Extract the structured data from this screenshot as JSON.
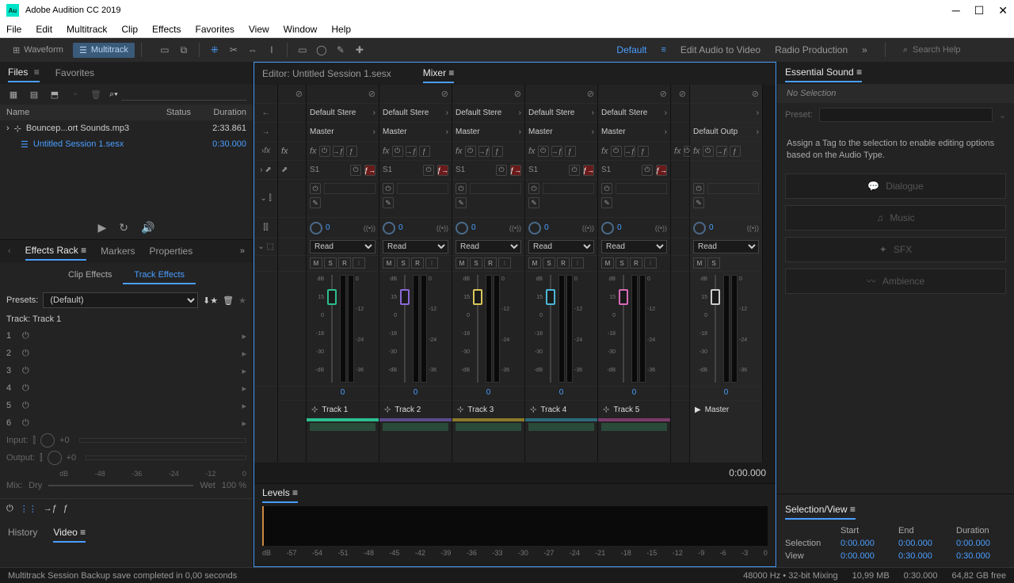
{
  "app": {
    "title": "Adobe Audition CC 2019",
    "icon_text": "Au"
  },
  "menu": [
    "File",
    "Edit",
    "Multitrack",
    "Clip",
    "Effects",
    "Favorites",
    "View",
    "Window",
    "Help"
  ],
  "modes": {
    "waveform": "Waveform",
    "multitrack": "Multitrack"
  },
  "workspaces": {
    "default": "Default",
    "eav": "Edit Audio to Video",
    "radio": "Radio Production"
  },
  "search": {
    "placeholder": "Search Help"
  },
  "files": {
    "tab1": "Files",
    "tab2": "Favorites",
    "headers": {
      "name": "Name",
      "status": "Status",
      "duration": "Duration"
    },
    "rows": [
      {
        "name": "Bouncep...ort Sounds.mp3",
        "dur": "2:33.861"
      },
      {
        "name": "Untitled Session 1.sesx",
        "dur": "0:30.000"
      }
    ]
  },
  "fx": {
    "panel": "Effects Rack",
    "markers": "Markers",
    "props": "Properties",
    "clipfx": "Clip Effects",
    "trackfx": "Track Effects",
    "presets_label": "Presets:",
    "preset_value": "(Default)",
    "track_label": "Track: Track 1",
    "input": "Input:",
    "output": "Output:",
    "plus0": "+0",
    "scale": [
      "dB",
      "-48",
      "-36",
      "-24",
      "-12",
      "0"
    ],
    "mix": "Mix:",
    "dry": "Dry",
    "wet": "Wet",
    "pct": "100 %"
  },
  "history": {
    "history": "History",
    "video": "Video"
  },
  "mixer": {
    "editor_tab": "Editor: Untitled Session 1.sesx",
    "mixer_tab": "Mixer",
    "default_stereo": "Default Stere",
    "master": "Master",
    "default_output": "Default Outp",
    "read": "Read",
    "s1": "S1",
    "pan": "0",
    "fader_scale": [
      "dB",
      "15",
      "0",
      "-18",
      "-30",
      "-dB"
    ],
    "meter_scale": [
      "0",
      "-12",
      "-24",
      "-36"
    ],
    "tracks": [
      {
        "name": "Track 1",
        "color": "#2dbd8e",
        "handle": "#2dbd8e"
      },
      {
        "name": "Track 2",
        "color": "#5a4a8a",
        "handle": "#8a6ad8"
      },
      {
        "name": "Track 3",
        "color": "#8a7a2a",
        "handle": "#d8c85a"
      },
      {
        "name": "Track 4",
        "color": "#2a6a7a",
        "handle": "#4ab8d8"
      },
      {
        "name": "Track 5",
        "color": "#7a3a6a",
        "handle": "#d86ab8"
      }
    ],
    "master_name": "Master",
    "vol": "0",
    "timecode": "0:00.000"
  },
  "levels": {
    "title": "Levels",
    "scale": [
      "dB",
      "-57",
      "-54",
      "-51",
      "-48",
      "-45",
      "-42",
      "-39",
      "-36",
      "-33",
      "-30",
      "-27",
      "-24",
      "-21",
      "-18",
      "-15",
      "-12",
      "-9",
      "-6",
      "-3",
      "0"
    ]
  },
  "es": {
    "title": "Essential Sound",
    "nosel": "No Selection",
    "preset": "Preset:",
    "hint": "Assign a Tag to the selection to enable editing options based on the Audio Type.",
    "dialogue": "Dialogue",
    "music": "Music",
    "sfx": "SFX",
    "ambience": "Ambience"
  },
  "selview": {
    "title": "Selection/View",
    "start": "Start",
    "end": "End",
    "dur": "Duration",
    "sel": "Selection",
    "view": "View",
    "sel_start": "0:00.000",
    "sel_end": "0:00.000",
    "sel_dur": "0:00.000",
    "view_start": "0:00.000",
    "view_end": "0:30.000",
    "view_dur": "0:30.000"
  },
  "status": {
    "msg": "Multitrack Session Backup save completed in 0,00 seconds",
    "format": "48000 Hz • 32-bit Mixing",
    "mem": "10,99 MB",
    "dur": "0:30.000",
    "disk": "64,82 GB free"
  }
}
